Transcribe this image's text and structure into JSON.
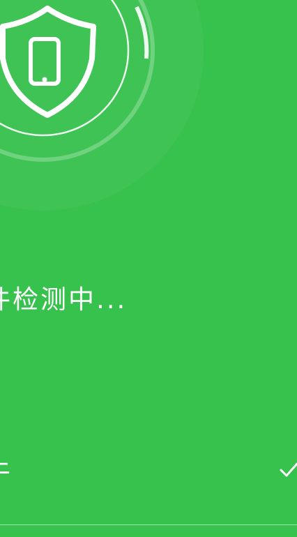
{
  "colors": {
    "background": "#37c14d",
    "foreground": "#ffffff"
  },
  "scan": {
    "status_text": "件检测中..."
  },
  "check_item": {
    "label": "牛",
    "status_icon": "checkmark-icon"
  },
  "shield": {
    "icon": "shield-phone-icon"
  }
}
